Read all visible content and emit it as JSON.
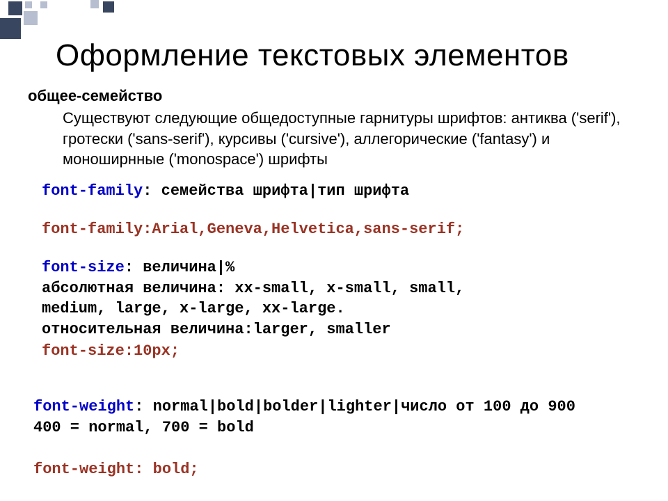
{
  "title": "Оформление текстовых элементов",
  "section": {
    "heading": "общее-семейство",
    "body": "Существуют следующие общедоступные гарнитуры шрифтов: антиква ('serif'), гротески ('sans-serif'), курсивы ('cursive'), аллегорические ('fantasy') и моноширнные ('monospace') шрифты"
  },
  "code": {
    "fontFamily": {
      "prop": "font-family",
      "rest": ": семейства шрифта|тип шрифта"
    },
    "fontFamilyExample": "font-family:Arial,Geneva,Helvetica,sans-serif;",
    "fontSize": {
      "prop": "font-size",
      "rest": ": величина|%",
      "line2": "абсолютная величина: xx-small, x-small, small,",
      "line3": "medium, large, x-large, xx-large.",
      "line4": "относительная величина:larger, smaller"
    },
    "fontSizeExample": "font-size:10px;",
    "fontWeight": {
      "prop": "font-weight",
      "rest": ": normal|bold|bolder|lighter|число от 100 до 900",
      "line2": "400 = normal, 700 = bold"
    },
    "fontWeightExample": "font-weight: bold;"
  }
}
